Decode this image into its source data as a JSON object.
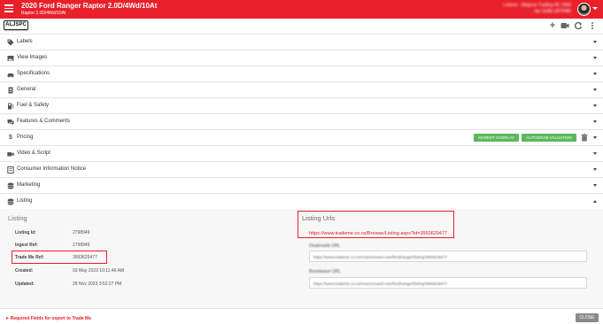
{
  "header": {
    "title": "2020 Ford Ranger Raptor 2.0D/4Wd/10At",
    "subtitle": "Raptor 2.0D/4Wd/10At",
    "user_line1": "Lukens - Magnus Trading 4C 1960",
    "user_line2": "Jan Sadly (ATR4B)",
    "accent": "#e8202a"
  },
  "toolbar": {
    "stock_code": "ALJSPC",
    "icons": [
      "plus-icon",
      "video-icon",
      "refresh-icon",
      "more-vertical-icon"
    ]
  },
  "sections": [
    {
      "label": "Labels",
      "icon": "tag-icon"
    },
    {
      "label": "View Images",
      "icon": "image-icon"
    },
    {
      "label": "Specifications",
      "icon": "car-icon"
    },
    {
      "label": "General",
      "icon": "document-icon"
    },
    {
      "label": "Fuel & Safety",
      "icon": "fuel-icon"
    },
    {
      "label": "Features & Comments",
      "icon": "comments-icon"
    },
    {
      "label": "Pricing",
      "icon": "dollar-icon"
    },
    {
      "label": "Video & Script",
      "icon": "video-icon"
    },
    {
      "label": "Consumer Information Notice",
      "icon": "notice-icon"
    },
    {
      "label": "Marketing",
      "icon": "database-icon"
    },
    {
      "label": "Listing",
      "icon": "database-icon"
    }
  ],
  "pricing_buttons": {
    "market_overlay": "MARKET OVERLAY",
    "autograb_valuation": "AUTOGRAB VALUATION"
  },
  "listing": {
    "title": "Listing",
    "fields": [
      {
        "label": "Listing Id:",
        "value": "2798949"
      },
      {
        "label": "Ingest Ref:",
        "value": "2798949"
      },
      {
        "label": "Trade Me Ref:",
        "value": "3993629477"
      },
      {
        "label": "Created:",
        "value": "03 May 2023 10:11:46 AM"
      },
      {
        "label": "Updated:",
        "value": "28 Nov 2023 3:52:27 PM"
      }
    ]
  },
  "listing_urls": {
    "title": "Listing Urls",
    "trademe_url": "https://www.trademe.co.nz/Browse/Listing.aspx?id=3993629477",
    "ds_label": "Dealerweb URL",
    "ds_url": "https://www.trademe.co.nz/motors/used-cars/ford/ranger/listing/3993629477",
    "dp_label": "Boostwave URL",
    "dp_url": "https://www.trademe.co.nz/motors/used-cars/ford/ranger/listing/3993629477"
  },
  "footer": {
    "required_note": "Required Fields for export to Trade Me",
    "close_label": "CLOSE"
  }
}
